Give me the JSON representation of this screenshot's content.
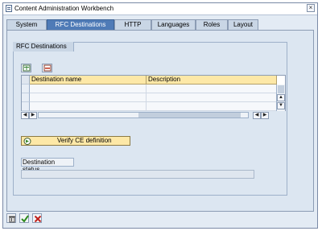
{
  "window": {
    "title": "Content Administration Workbench",
    "close_label": "×"
  },
  "tabs": [
    {
      "label": "System"
    },
    {
      "label": "RFC Destinations",
      "active": true
    },
    {
      "label": "HTTP"
    },
    {
      "label": "Languages"
    },
    {
      "label": "Roles"
    },
    {
      "label": "Layout"
    }
  ],
  "group": {
    "label": "RFC Destinations"
  },
  "toolbar": {
    "icons": [
      "add-row-icon",
      "delete-row-icon"
    ]
  },
  "table": {
    "columns": [
      "Destination name",
      "Description"
    ],
    "rows": [
      [
        "",
        ""
      ],
      [
        "",
        ""
      ],
      [
        "",
        ""
      ]
    ]
  },
  "verify_button": {
    "label": "Verify CE definition",
    "icon": "execute-icon"
  },
  "destination_status": {
    "label": "Destination status",
    "value": ""
  },
  "footer": {
    "icons": [
      "trash-icon",
      "confirm-icon",
      "cancel-icon"
    ]
  },
  "colors": {
    "active_tab": "#4f7bb7",
    "header_yellow": "#fde8a7",
    "background": "#dce6f1"
  }
}
